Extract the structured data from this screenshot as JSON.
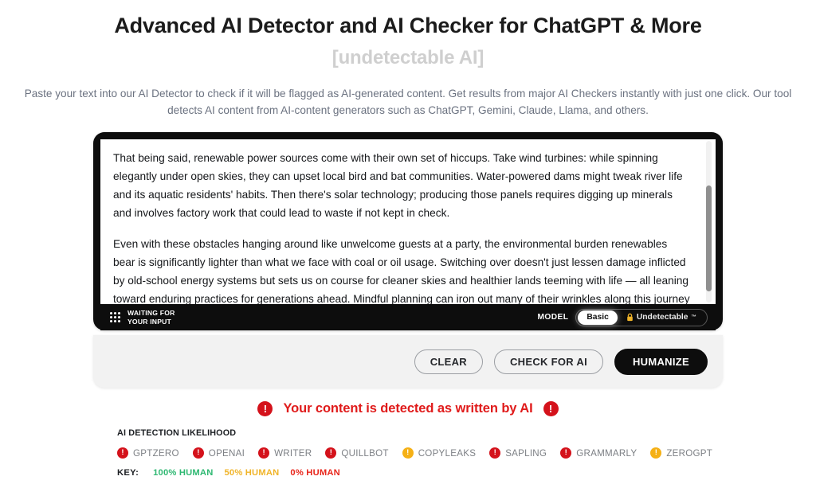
{
  "header": {
    "title": "Advanced AI Detector and AI Checker for ChatGPT & More",
    "subtitle": "[undetectable AI]",
    "description": "Paste your text into our AI Detector to check if it will be flagged as AI-generated content. Get results from major AI Checkers instantly with just one click. Our tool detects AI content from AI-content generators such as ChatGPT, Gemini, Claude, Llama, and others."
  },
  "editor": {
    "paragraph1": "That being said, renewable power sources come with their own set of hiccups. Take wind turbines: while spinning elegantly under open skies, they can upset local bird and bat communities. Water-powered dams might tweak river life and its aquatic residents' habits. Then there's solar technology; producing those panels requires digging up minerals and involves factory work that could lead to waste if not kept in check.",
    "paragraph2": "Even with these obstacles hanging around like unwelcome guests at a party, the environmental burden renewables bear is significantly lighter than what we face with coal or oil usage. Switching over doesn't just lessen damage inflicted by old-school energy systems but sets us on course for cleaner skies and healthier lands teeming with life — all leaning toward enduring practices for generations ahead. Mindful planning can iron out many of their wrinkles along this journey toward sustainability."
  },
  "statusbar": {
    "status_line1": "WAITING FOR",
    "status_line2": "YOUR INPUT",
    "model_label": "MODEL",
    "options": [
      {
        "label": "Basic",
        "active": true,
        "locked": false
      },
      {
        "label": "Undetectable",
        "trademark": "™",
        "active": false,
        "locked": true
      }
    ]
  },
  "actions": {
    "clear_label": "CLEAR",
    "check_label": "CHECK FOR AI",
    "humanize_label": "HUMANIZE"
  },
  "result": {
    "message": "Your content is detected as written by AI",
    "icon_left": "alert-icon",
    "icon_right": "alert-icon",
    "color": "#e01b1b"
  },
  "likelihood": {
    "title": "AI DETECTION LIKELIHOOD",
    "detectors": [
      {
        "name": "GPTZERO",
        "status": "red",
        "color": "#d4121b"
      },
      {
        "name": "OPENAI",
        "status": "red",
        "color": "#d4121b"
      },
      {
        "name": "WRITER",
        "status": "red",
        "color": "#d4121b"
      },
      {
        "name": "QUILLBOT",
        "status": "red",
        "color": "#d4121b"
      },
      {
        "name": "COPYLEAKS",
        "status": "yellow",
        "color": "#f5b015"
      },
      {
        "name": "SAPLING",
        "status": "red",
        "color": "#d4121b"
      },
      {
        "name": "GRAMMARLY",
        "status": "red",
        "color": "#d4121b"
      },
      {
        "name": "ZEROGPT",
        "status": "yellow",
        "color": "#f5b015"
      }
    ],
    "key_label": "KEY:",
    "key_items": [
      {
        "label": "100% HUMAN",
        "color": "#2eb872"
      },
      {
        "label": "50% HUMAN",
        "color": "#f0b429"
      },
      {
        "label": "0% HUMAN",
        "color": "#e8261b"
      }
    ]
  }
}
